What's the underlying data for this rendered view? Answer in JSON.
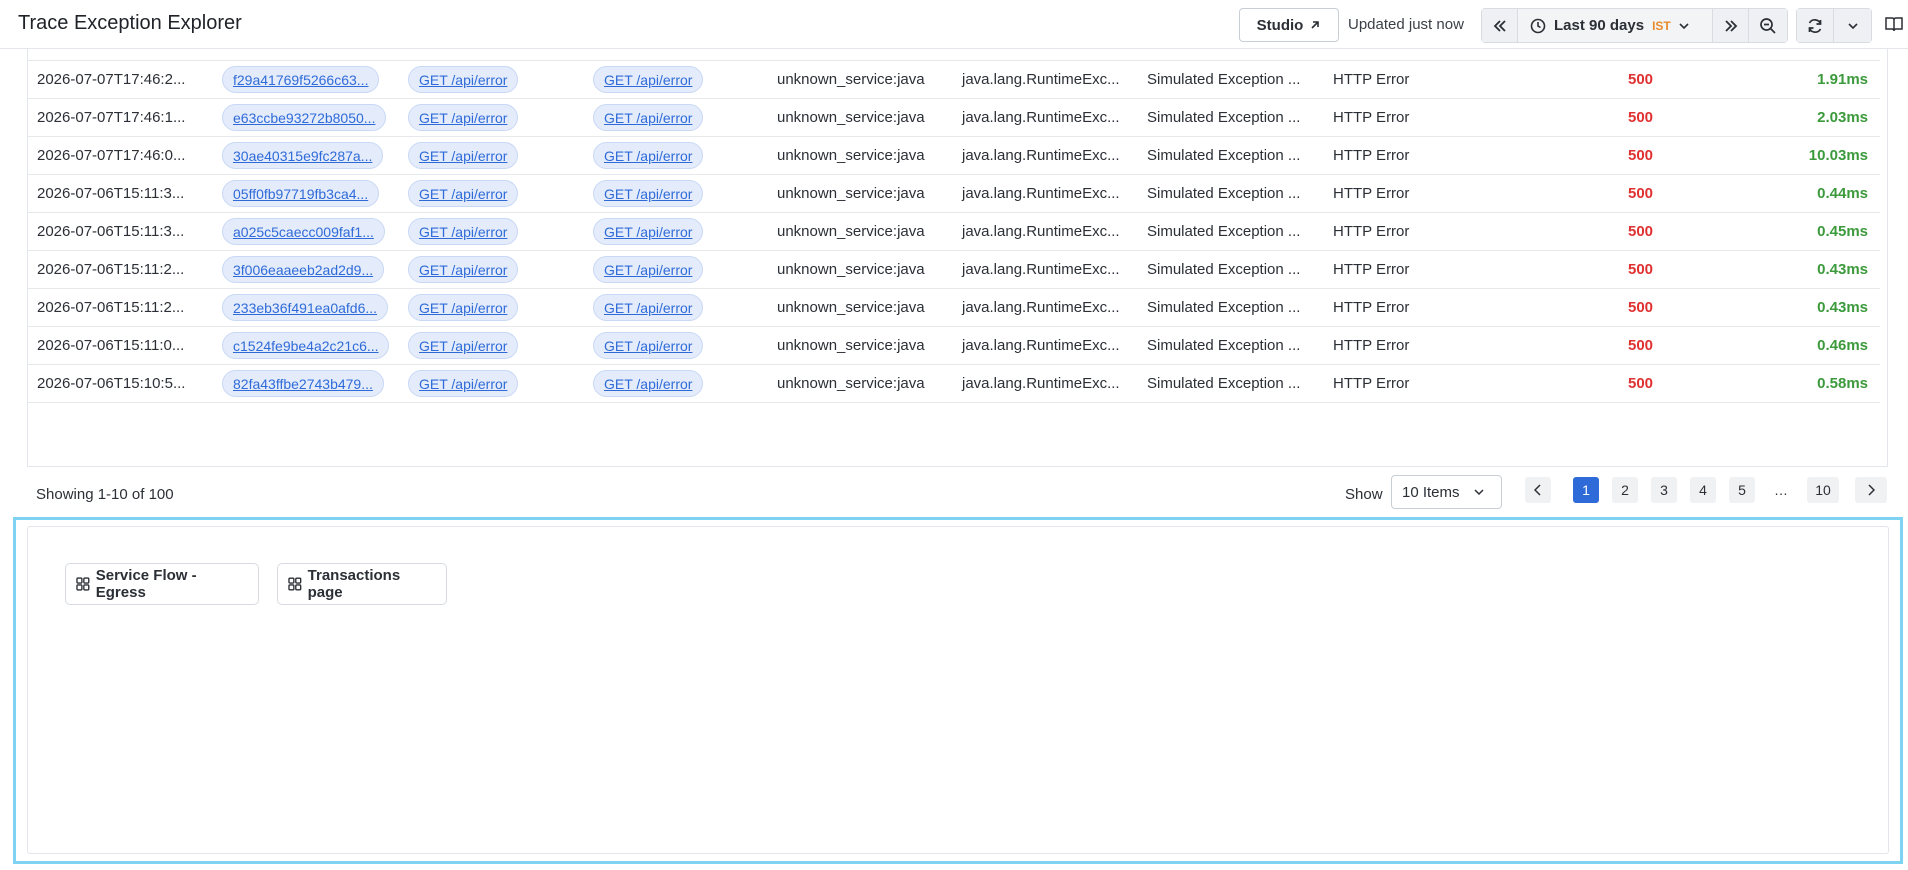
{
  "header": {
    "title": "Trace Exception Explorer",
    "studio_label": "Studio",
    "updated_text": "Updated just now",
    "time_range": "Last 90 days",
    "timezone": "IST"
  },
  "table": {
    "rows": [
      {
        "time": "2026-07-07T17:46:2...",
        "trace_id": "f29a41769f5266c63...",
        "operation": "GET /api/error",
        "root": "GET /api/error",
        "service": "unknown_service:java",
        "exception": "java.lang.RuntimeExc...",
        "message": "Simulated Exception ...",
        "type": "HTTP Error",
        "status": "500",
        "duration": "1.91ms"
      },
      {
        "time": "2026-07-07T17:46:1...",
        "trace_id": "e63ccbe93272b8050...",
        "operation": "GET /api/error",
        "root": "GET /api/error",
        "service": "unknown_service:java",
        "exception": "java.lang.RuntimeExc...",
        "message": "Simulated Exception ...",
        "type": "HTTP Error",
        "status": "500",
        "duration": "2.03ms"
      },
      {
        "time": "2026-07-07T17:46:0...",
        "trace_id": "30ae40315e9fc287a...",
        "operation": "GET /api/error",
        "root": "GET /api/error",
        "service": "unknown_service:java",
        "exception": "java.lang.RuntimeExc...",
        "message": "Simulated Exception ...",
        "type": "HTTP Error",
        "status": "500",
        "duration": "10.03ms"
      },
      {
        "time": "2026-07-06T15:11:3...",
        "trace_id": "05ff0fb97719fb3ca4...",
        "operation": "GET /api/error",
        "root": "GET /api/error",
        "service": "unknown_service:java",
        "exception": "java.lang.RuntimeExc...",
        "message": "Simulated Exception ...",
        "type": "HTTP Error",
        "status": "500",
        "duration": "0.44ms"
      },
      {
        "time": "2026-07-06T15:11:3...",
        "trace_id": "a025c5caecc009faf1...",
        "operation": "GET /api/error",
        "root": "GET /api/error",
        "service": "unknown_service:java",
        "exception": "java.lang.RuntimeExc...",
        "message": "Simulated Exception ...",
        "type": "HTTP Error",
        "status": "500",
        "duration": "0.45ms"
      },
      {
        "time": "2026-07-06T15:11:2...",
        "trace_id": "3f006eaaeeb2ad2d9...",
        "operation": "GET /api/error",
        "root": "GET /api/error",
        "service": "unknown_service:java",
        "exception": "java.lang.RuntimeExc...",
        "message": "Simulated Exception ...",
        "type": "HTTP Error",
        "status": "500",
        "duration": "0.43ms"
      },
      {
        "time": "2026-07-06T15:11:2...",
        "trace_id": "233eb36f491ea0afd6...",
        "operation": "GET /api/error",
        "root": "GET /api/error",
        "service": "unknown_service:java",
        "exception": "java.lang.RuntimeExc...",
        "message": "Simulated Exception ...",
        "type": "HTTP Error",
        "status": "500",
        "duration": "0.43ms"
      },
      {
        "time": "2026-07-06T15:11:0...",
        "trace_id": "c1524fe9be4a2c21c6...",
        "operation": "GET /api/error",
        "root": "GET /api/error",
        "service": "unknown_service:java",
        "exception": "java.lang.RuntimeExc...",
        "message": "Simulated Exception ...",
        "type": "HTTP Error",
        "status": "500",
        "duration": "0.46ms"
      },
      {
        "time": "2026-07-06T15:10:5...",
        "trace_id": "82fa43ffbe2743b479...",
        "operation": "GET /api/error",
        "root": "GET /api/error",
        "service": "unknown_service:java",
        "exception": "java.lang.RuntimeExc...",
        "message": "Simulated Exception ...",
        "type": "HTTP Error",
        "status": "500",
        "duration": "0.58ms"
      }
    ]
  },
  "pagination": {
    "showing": "Showing 1-10 of 100",
    "show_label": "Show",
    "page_size": "10 Items",
    "pages": [
      "1",
      "2",
      "3",
      "4",
      "5",
      "…",
      "10"
    ],
    "current_page": "1"
  },
  "panel": {
    "buttons": [
      "Service Flow - Egress",
      "Transactions page"
    ]
  },
  "colors": {
    "status_error": "#e03131",
    "duration_ok": "#3c9a3c",
    "link": "#2f6bd8",
    "panel_highlight": "#7fd3f2"
  }
}
